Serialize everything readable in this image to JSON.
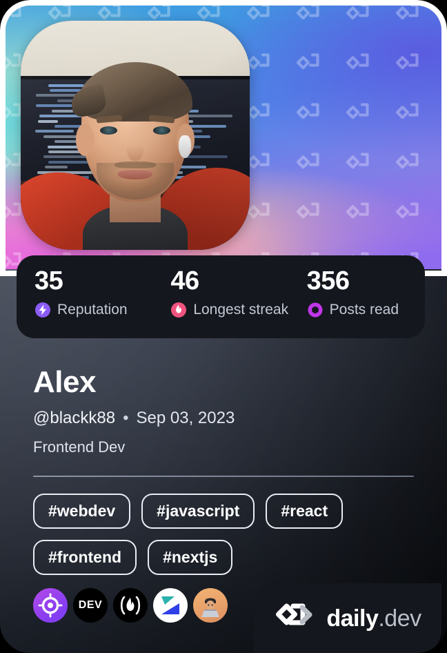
{
  "card": {
    "type": "daily.dev devcard",
    "accent_colors": {
      "reputation": "#8b5cf6",
      "streak": "#f1537f",
      "posts_read": "#c036e8",
      "card_dark": "#14171d",
      "body_slate": "#3d4350"
    }
  },
  "stats": [
    {
      "value": "35",
      "label": "Reputation",
      "icon": "bolt-icon",
      "color": "#8b5cf6"
    },
    {
      "value": "46",
      "label": "Longest streak",
      "icon": "flame-icon",
      "color": "#f1537f"
    },
    {
      "value": "356",
      "label": "Posts read",
      "icon": "ring-icon",
      "color": "#c036e8"
    }
  ],
  "profile": {
    "name": "Alex",
    "handle": "@blackk88",
    "separator": "•",
    "joined": "Sep 03, 2023",
    "role": "Frontend Dev",
    "avatar_alt": "Portrait of Alex in a red hoodie in front of code monitors"
  },
  "tags": [
    "#webdev",
    "#javascript",
    "#react",
    "#frontend",
    "#nextjs"
  ],
  "badges": [
    {
      "name": "daily-dev-target-badge",
      "label": "daily.dev"
    },
    {
      "name": "dev-to-badge",
      "label": "DEV"
    },
    {
      "name": "hacker-news-badge",
      "label": "Hacker News"
    },
    {
      "name": "pragmatic-engineer-badge",
      "label": "The Pragmatic Engineer"
    },
    {
      "name": "devsquad-avatar-badge",
      "label": "@devsquad"
    }
  ],
  "logo": {
    "brand": "daily",
    "suffix": ".dev"
  }
}
